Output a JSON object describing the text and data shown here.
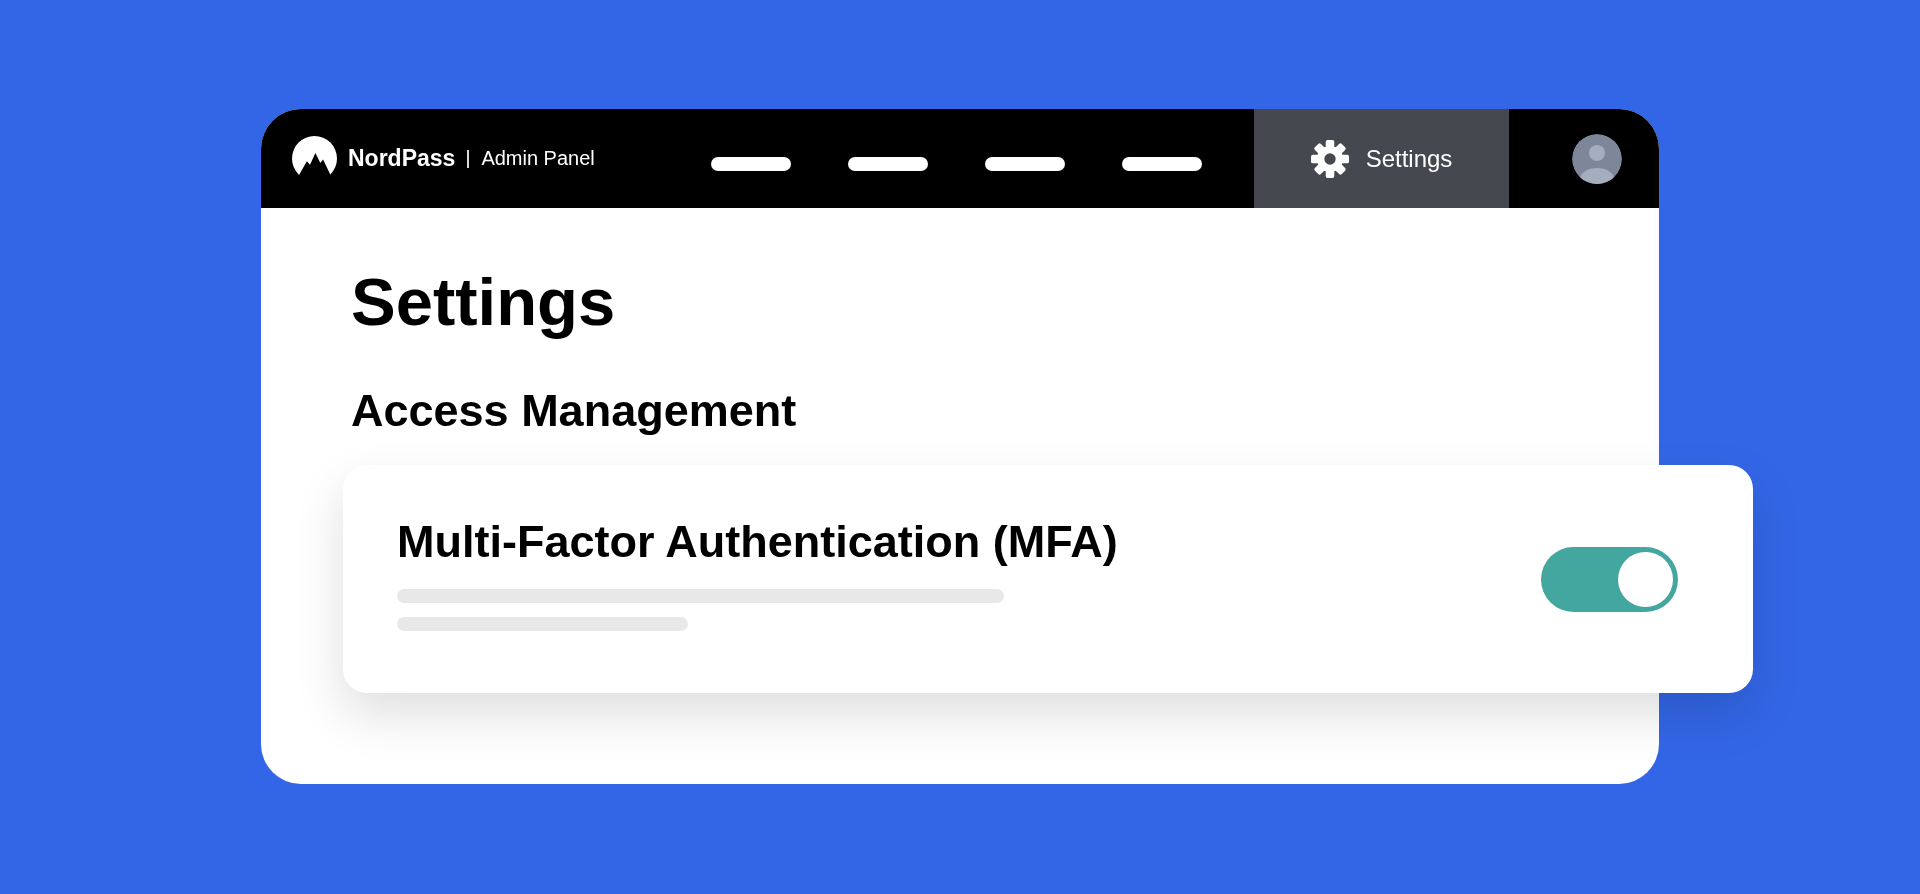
{
  "header": {
    "brand": {
      "name": "NordPass",
      "product": "Admin Panel"
    },
    "tabs": [
      {
        "label": "Settings",
        "selected": true
      }
    ]
  },
  "page": {
    "title": "Settings",
    "section": "Access Management"
  },
  "settings": [
    {
      "kind": "toggle",
      "title": "Multi-Factor Authentication (MFA)",
      "on": true
    }
  ]
}
